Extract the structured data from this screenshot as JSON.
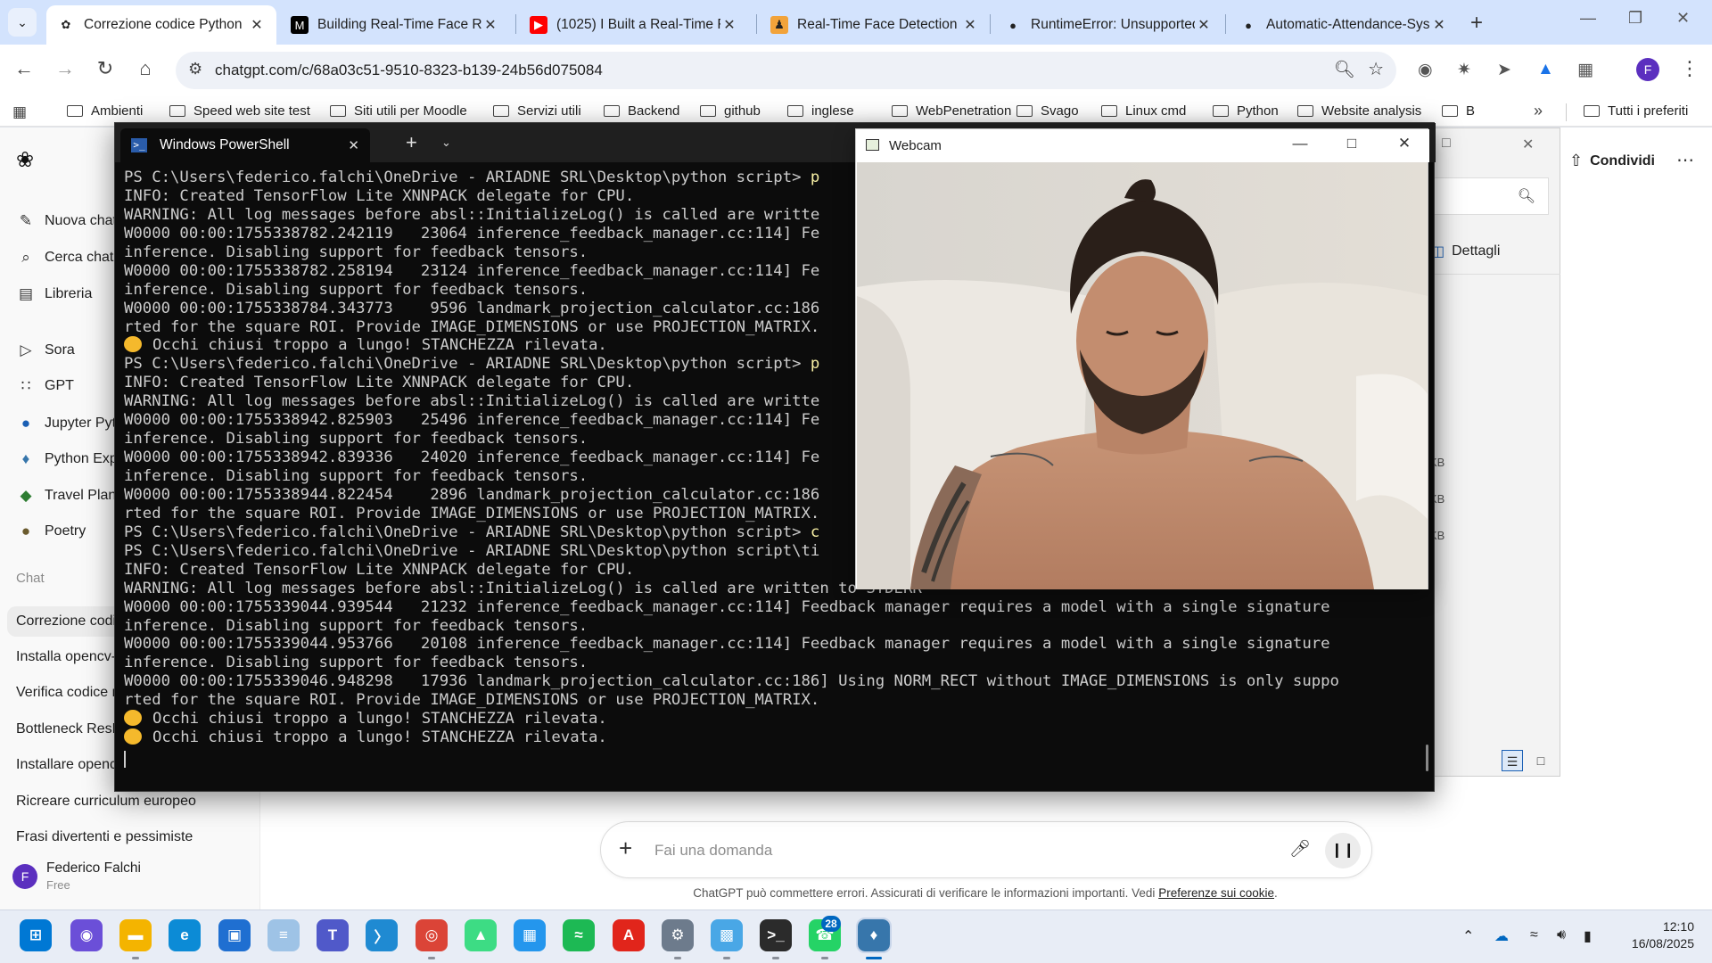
{
  "browser": {
    "tabs": [
      {
        "title": "Correzione codice Python",
        "active": true,
        "icon": "chatgpt-icon"
      },
      {
        "title": "Building Real-Time Face Re",
        "active": false,
        "icon": "medium-icon"
      },
      {
        "title": "(1025) I Built a Real-Time F",
        "active": false,
        "icon": "youtube-icon"
      },
      {
        "title": "Real-Time Face Detection &",
        "active": false,
        "icon": "person-icon"
      },
      {
        "title": "RuntimeError: Unsupported",
        "active": false,
        "icon": "github-icon"
      },
      {
        "title": "Automatic-Attendance-Sys",
        "active": false,
        "icon": "github-icon"
      }
    ],
    "url": "chatgpt.com/c/68a03c51-9510-8323-b139-24b56d075084",
    "bookmarks": [
      "Ambienti",
      "Speed web site test",
      "Siti utili per Moodle",
      "Servizi utili",
      "Backend",
      "github",
      "inglese",
      "WebPenetration",
      "Svago",
      "Linux cmd",
      "Python",
      "Website analysis",
      "B"
    ],
    "all_bookmarks": "Tutti i preferiti",
    "profile_initial": "F"
  },
  "chatgpt": {
    "sidebar": {
      "nav": [
        {
          "label": "Nuova chat",
          "icon": "new-chat-icon"
        },
        {
          "label": "Cerca chat",
          "icon": "search-icon"
        },
        {
          "label": "Libreria",
          "icon": "library-icon"
        }
      ],
      "apps": [
        {
          "label": "Sora",
          "icon": "sora-icon"
        },
        {
          "label": "GPT",
          "icon": "gpt-grid-icon"
        },
        {
          "label": "Jupyter Pyth",
          "icon": "jupyter-icon"
        },
        {
          "label": "Python Expe",
          "icon": "python-icon"
        },
        {
          "label": "Travel Planne",
          "icon": "travel-icon"
        },
        {
          "label": "Poetry",
          "icon": "poetry-icon"
        }
      ],
      "section_label": "Chat",
      "chats": [
        "Correzione codi",
        "Installa opencv-",
        "Verifica codice r",
        "Bottleneck ResN",
        "Installare openc",
        "Ricreare curriculum europeo",
        "Frasi divertenti e pessimiste"
      ],
      "user": {
        "initial": "F",
        "name": "Federico Falchi",
        "plan": "Free"
      }
    },
    "share_label": "Condividi",
    "composer_placeholder": "Fai una domanda",
    "disclaimer": "ChatGPT può commettere errori. Assicurati di verificare le informazioni importanti. Vedi",
    "disclaimer_link": "Preferenze sui cookie",
    "disclaimer_end": "."
  },
  "explorer": {
    "details_label": "Dettagli",
    "size_fragments": [
      "KB",
      "KB",
      "KB"
    ]
  },
  "powershell": {
    "tab_title": "Windows PowerShell",
    "lines": [
      {
        "text": "PS C:\\Users\\federico.falchi\\OneDrive - ARIADNE SRL\\Desktop\\python script> ",
        "cmd": "p",
        "emoji": false
      },
      {
        "text": "INFO: Created TensorFlow Lite XNNPACK delegate for CPU.",
        "emoji": false
      },
      {
        "text": "WARNING: All log messages before absl::InitializeLog() is called are writte",
        "emoji": false
      },
      {
        "text": "W0000 00:00:1755338782.242119   23064 inference_feedback_manager.cc:114] Fe",
        "emoji": false
      },
      {
        "text": "inference. Disabling support for feedback tensors.",
        "emoji": false
      },
      {
        "text": "W0000 00:00:1755338782.258194   23124 inference_feedback_manager.cc:114] Fe",
        "emoji": false
      },
      {
        "text": "inference. Disabling support for feedback tensors.",
        "emoji": false
      },
      {
        "text": "W0000 00:00:1755338784.343773    9596 landmark_projection_calculator.cc:186",
        "emoji": false
      },
      {
        "text": "rted for the square ROI. Provide IMAGE_DIMENSIONS or use PROJECTION_MATRIX.",
        "emoji": false
      },
      {
        "text": "Occhi chiusi troppo a lungo! STANCHEZZA rilevata.",
        "emoji": true
      },
      {
        "text": "PS C:\\Users\\federico.falchi\\OneDrive - ARIADNE SRL\\Desktop\\python script> ",
        "cmd": "p",
        "emoji": false
      },
      {
        "text": "INFO: Created TensorFlow Lite XNNPACK delegate for CPU.",
        "emoji": false
      },
      {
        "text": "WARNING: All log messages before absl::InitializeLog() is called are writte",
        "emoji": false
      },
      {
        "text": "W0000 00:00:1755338942.825903   25496 inference_feedback_manager.cc:114] Fe",
        "emoji": false
      },
      {
        "text": "inference. Disabling support for feedback tensors.",
        "emoji": false
      },
      {
        "text": "W0000 00:00:1755338942.839336   24020 inference_feedback_manager.cc:114] Fe",
        "emoji": false
      },
      {
        "text": "inference. Disabling support for feedback tensors.",
        "emoji": false
      },
      {
        "text": "W0000 00:00:1755338944.822454    2896 landmark_projection_calculator.cc:186",
        "emoji": false
      },
      {
        "text": "rted for the square ROI. Provide IMAGE_DIMENSIONS or use PROJECTION_MATRIX.",
        "emoji": false
      },
      {
        "text": "PS C:\\Users\\federico.falchi\\OneDrive - ARIADNE SRL\\Desktop\\python script> ",
        "cmd": "c",
        "emoji": false
      },
      {
        "text": "PS C:\\Users\\federico.falchi\\OneDrive - ARIADNE SRL\\Desktop\\python script\\ti",
        "emoji": false
      },
      {
        "text": "INFO: Created TensorFlow Lite XNNPACK delegate for CPU.",
        "emoji": false
      },
      {
        "text": "WARNING: All log messages before absl::InitializeLog() is called are written to STDERR",
        "emoji": false
      },
      {
        "text": "W0000 00:00:1755339044.939544   21232 inference_feedback_manager.cc:114] Feedback manager requires a model with a single signature",
        "emoji": false
      },
      {
        "text": "inference. Disabling support for feedback tensors.",
        "emoji": false
      },
      {
        "text": "W0000 00:00:1755339044.953766   20108 inference_feedback_manager.cc:114] Feedback manager requires a model with a single signature",
        "emoji": false
      },
      {
        "text": "inference. Disabling support for feedback tensors.",
        "emoji": false
      },
      {
        "text": "W0000 00:00:1755339046.948298   17936 landmark_projection_calculator.cc:186] Using NORM_RECT without IMAGE_DIMENSIONS is only suppo",
        "emoji": false
      },
      {
        "text": "rted for the square ROI. Provide IMAGE_DIMENSIONS or use PROJECTION_MATRIX.",
        "emoji": false
      },
      {
        "text": "Occhi chiusi troppo a lungo! STANCHEZZA rilevata.",
        "emoji": true
      },
      {
        "text": "Occhi chiusi troppo a lungo! STANCHEZZA rilevata.",
        "emoji": true
      }
    ]
  },
  "webcam": {
    "title": "Webcam",
    "feed": "webcam-feed-person-image"
  },
  "taskbar": {
    "apps": [
      "start-icon",
      "copilot-icon",
      "file-explorer-icon",
      "edge-icon",
      "store-icon",
      "notepad-icon",
      "teams-icon",
      "vscode-icon",
      "chrome-icon",
      "android-studio-icon",
      "docker-icon",
      "spotify-icon",
      "acrobat-icon",
      "settings-icon",
      "paint-icon",
      "terminal-icon",
      "whatsapp-icon",
      "python-idle-icon"
    ],
    "whatsapp_badge": "28",
    "time": "12:10",
    "date": "16/08/2025"
  },
  "colors": {
    "chrome_tabstrip": "#d3e3fd",
    "terminal_bg": "#0c0c0c",
    "terminal_text": "#cccccc",
    "terminal_command": "#f9f1a5",
    "accent": "#0067c0",
    "avatar": "#5b2fbf"
  }
}
